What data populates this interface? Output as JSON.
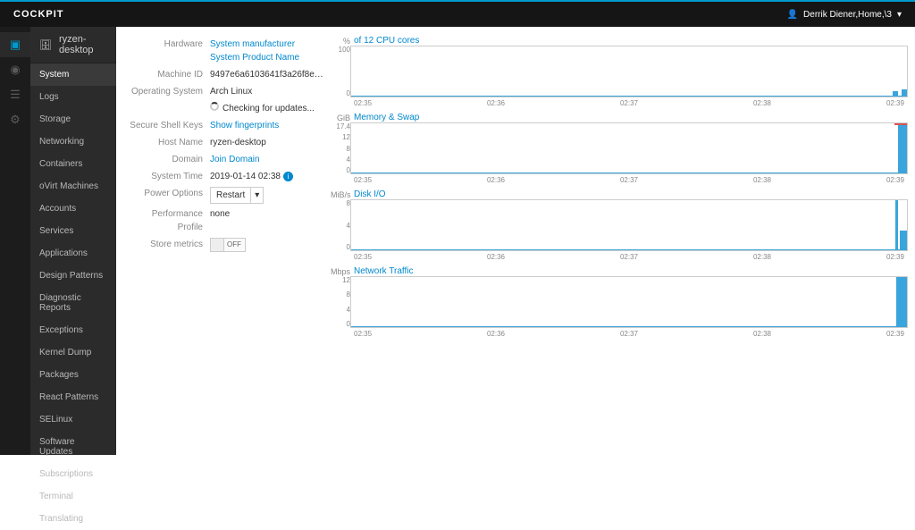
{
  "header": {
    "brand": "COCKPIT",
    "user_label": "Derrik Diener,Home,\\3"
  },
  "sidebar": {
    "host": "ryzen-desktop",
    "items": [
      {
        "label": "System",
        "active": true
      },
      {
        "label": "Logs"
      },
      {
        "label": "Storage"
      },
      {
        "label": "Networking"
      },
      {
        "label": "Containers"
      },
      {
        "label": "oVirt Machines"
      },
      {
        "label": "Accounts"
      },
      {
        "label": "Services"
      },
      {
        "label": "Applications"
      },
      {
        "label": "Design Patterns"
      },
      {
        "label": "Diagnostic Reports"
      },
      {
        "label": "Exceptions"
      },
      {
        "label": "Kernel Dump"
      },
      {
        "label": "Packages"
      },
      {
        "label": "React Patterns"
      },
      {
        "label": "SELinux"
      },
      {
        "label": "Software Updates"
      },
      {
        "label": "Subscriptions"
      },
      {
        "label": "Terminal"
      },
      {
        "label": "Translating"
      }
    ]
  },
  "info": {
    "hardware_label": "Hardware",
    "hardware_value": "System manufacturer System Product Name",
    "machine_id_label": "Machine ID",
    "machine_id_value": "9497e6a6103641f3a26f8ea4...",
    "os_label": "Operating System",
    "os_value": "Arch Linux",
    "updates_value": "Checking for updates...",
    "ssh_label": "Secure Shell Keys",
    "ssh_value": "Show fingerprints",
    "hostname_label": "Host Name",
    "hostname_value": "ryzen-desktop",
    "domain_label": "Domain",
    "domain_value": "Join Domain",
    "systime_label": "System Time",
    "systime_value": "2019-01-14 02:38",
    "power_label": "Power Options",
    "power_value": "Restart",
    "profile_label": "Performance Profile",
    "profile_value": "none",
    "metrics_label": "Store metrics",
    "metrics_value": "OFF"
  },
  "charts": {
    "times": [
      "02:35",
      "02:36",
      "02:37",
      "02:38",
      "02:39"
    ],
    "cpu": {
      "unit": "%",
      "title": "of 12 CPU cores",
      "ymax": "100",
      "ymin": "0"
    },
    "mem": {
      "unit": "GiB",
      "title": "Memory & Swap",
      "ymax": "17.4",
      "y2": "12",
      "y3": "8",
      "y4": "4",
      "ymin": "0"
    },
    "disk": {
      "unit": "MiB/s",
      "title": "Disk I/O",
      "ymax": "8",
      "y2": "4",
      "ymin": "0"
    },
    "net": {
      "unit": "Mbps",
      "title": "Network Traffic",
      "ymax": "12",
      "y2": "8",
      "y3": "4",
      "ymin": "0"
    }
  },
  "chart_data": [
    {
      "type": "line",
      "title": "% of 12 CPU cores",
      "xlabel": "",
      "ylabel": "%",
      "ylim": [
        0,
        100
      ],
      "x_ticks": [
        "02:35",
        "02:36",
        "02:37",
        "02:38",
        "02:39"
      ],
      "values": [
        0,
        0,
        0,
        0,
        8
      ]
    },
    {
      "type": "area",
      "title": "Memory & Swap",
      "xlabel": "",
      "ylabel": "GiB",
      "ylim": [
        0,
        17.4
      ],
      "x_ticks": [
        "02:35",
        "02:36",
        "02:37",
        "02:38",
        "02:39"
      ],
      "series": [
        {
          "name": "Memory",
          "values": [
            0,
            0,
            0,
            0,
            17
          ]
        },
        {
          "name": "Swap",
          "values": [
            0,
            0,
            0,
            0,
            17.4
          ]
        }
      ]
    },
    {
      "type": "line",
      "title": "Disk I/O",
      "xlabel": "",
      "ylabel": "MiB/s",
      "ylim": [
        0,
        8
      ],
      "x_ticks": [
        "02:35",
        "02:36",
        "02:37",
        "02:38",
        "02:39"
      ],
      "values": [
        0,
        0,
        0,
        0,
        8
      ]
    },
    {
      "type": "area",
      "title": "Network Traffic",
      "xlabel": "",
      "ylabel": "Mbps",
      "ylim": [
        0,
        12
      ],
      "x_ticks": [
        "02:35",
        "02:36",
        "02:37",
        "02:38",
        "02:39"
      ],
      "values": [
        0,
        0,
        0,
        0,
        12
      ]
    }
  ]
}
